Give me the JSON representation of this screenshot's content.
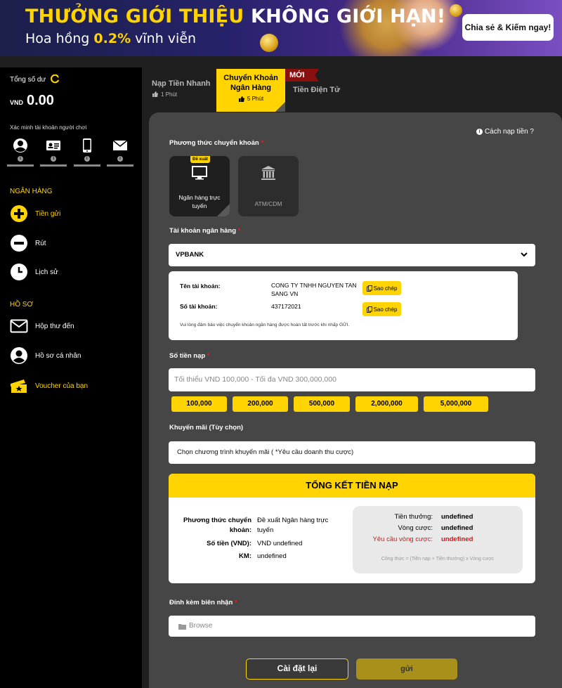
{
  "banner": {
    "headline_yellow": "THƯỞNG GIỚI THIỆU",
    "headline_white": "KHÔNG GIỚI HẠN!",
    "sub_prefix": "Hoa hồng ",
    "sub_percent": "0.2%",
    "sub_suffix": " vĩnh viễn",
    "share_button": "Chia sẻ & Kiếm ngay!"
  },
  "sidebar": {
    "balance_label": "Tổng số dư",
    "currency": "VND",
    "amount": "0.00",
    "verify_label": "Xác minh tài khoản người chơi",
    "verify_items": [
      "user-icon",
      "id-card-icon",
      "phone-icon",
      "mail-icon"
    ],
    "bank_section": "NGÂN HÀNG",
    "bank_items": [
      "Tiền gửi",
      "Rút",
      "Lịch sử"
    ],
    "profile_section": "HỒ SƠ",
    "profile_items": [
      "Hộp thư đến",
      "Hồ sơ cá nhân",
      "Voucher của bạn"
    ]
  },
  "tabs": [
    {
      "label": "Nạp Tiền Nhanh",
      "sub": "1 Phút"
    },
    {
      "label": "Chuyển Khoản Ngân Hàng",
      "sub": "5 Phút"
    },
    {
      "label": "Tiền Điện Tử",
      "badge": "MỚI"
    }
  ],
  "form": {
    "howto": "Cách nạp tiền ?",
    "method_label": "Phương thức chuyển khoản",
    "methods": [
      {
        "badge": "Đề xuất",
        "label": "Ngân hàng trực tuyến"
      },
      {
        "label": "ATM/CDM"
      }
    ],
    "bank_account_label": "Tài khoản ngân hàng",
    "bank_selected": "VPBANK",
    "account_name_key": "Tên tài khoản:",
    "account_name_value": "CONG TY TNHH NGUYEN TAN SANG VN",
    "account_number_key": "Số tài khoản:",
    "account_number_value": "437172021",
    "copy_label": "Sao chép",
    "note": "Vui lòng đảm bảo việc chuyển khoản ngân hàng được hoàn tất trước khi nhấp GỬI.",
    "amount_label": "Số tiền nạp",
    "amount_placeholder": "Tối thiểu VND 100,000  - Tối đa VND 300,000,000",
    "quick_amounts": [
      "100,000",
      "200,000",
      "500,000",
      "2,000,000",
      "5,000,000"
    ],
    "promo_label": "Khuyến mãi (Tùy chọn)",
    "promo_value": "Chọn chương trình khuyến mãi ( *Yêu cầu doanh thu cược)",
    "summary_title": "TỔNG KẾT TIỀN NẠP",
    "summary_method_key": "Phương thức chuyển khoản:",
    "summary_method_value": "Đề xuất Ngân hàng trực tuyến",
    "summary_amount_key": "Số tiền (VND):",
    "summary_amount_value": "VND undefined",
    "summary_km_key": "KM:",
    "summary_km_value": "undefined",
    "bonus_key": "Tiền thưởng:",
    "bonus_value": "undefined",
    "rounds_key": "Vòng cược:",
    "rounds_value": "undefined",
    "req_key": "Yêu cầu vòng cược:",
    "req_value": "undefined",
    "formula": "Công thức = (Tiền nạp + Tiền thưởng) x Vòng cược",
    "attach_label": "Đính kèm biên nhận",
    "browse": "Browse",
    "reset_button": "Cài đặt lại",
    "send_button": "gửi"
  },
  "colors": {
    "accent": "#ffd400",
    "panel": "#464646",
    "sidebar": "#000000",
    "danger": "#d01818"
  }
}
